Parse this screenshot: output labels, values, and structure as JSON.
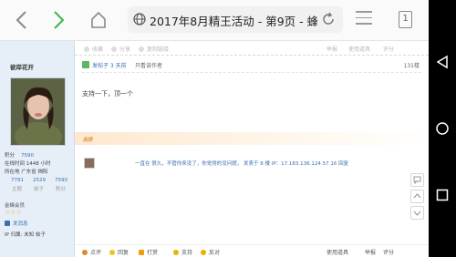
{
  "browser": {
    "url_title": "2017年8月精王活动 - 第9页 - 蜂友...",
    "tab_count": "1"
  },
  "sidebar": {
    "username": "彼岸花开",
    "stats": {
      "jifen_label": "积分",
      "jifen_value": "7590",
      "online_label": "在线时间",
      "online_value": "1448 小时",
      "location_label": "所在地",
      "location_value": "广东省 揭阳"
    },
    "counts": [
      "7791",
      "2529",
      "7590"
    ],
    "counts_labels": [
      "主题",
      "帖子",
      "积分"
    ],
    "group_label": "金蜂会员",
    "stars": "☆☆☆",
    "send_msg": "发消息",
    "ip_line": "IP 归属: 未知 帖子"
  },
  "top_toolbar": {
    "items": [
      "收藏",
      "分享",
      "复制链接"
    ],
    "right_items": [
      "举报",
      "使用道具",
      "评分"
    ]
  },
  "post": {
    "badge": "发帖子 3 天前",
    "author_note": "只看该作者",
    "floor": "131楼",
    "content": "支持一下，顶一个",
    "rating_label": "点评",
    "rating_text": "一直在  很久，不管你来没了，你觉得的没问题， 发表于 8 楼 IP：17.183.136.124.57.16 回复"
  },
  "bottom_bar": {
    "items": [
      "点评",
      "回复",
      "打赏",
      "支持",
      "反对"
    ],
    "right_items": [
      "使用道具",
      "举报",
      "评分"
    ]
  },
  "colors": {
    "sidebar_bg": "#e6eff7",
    "link": "#3d6fb0",
    "accent_orange": "#e08a2a",
    "nav_arrow": "#4caf50"
  }
}
